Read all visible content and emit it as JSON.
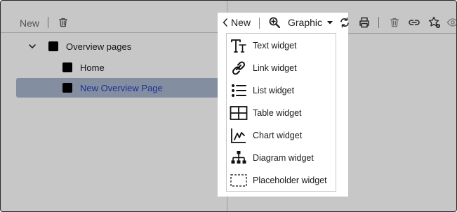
{
  "left_toolbar": {
    "new_label": "New",
    "delete_icon": "trash-icon"
  },
  "tree": {
    "items": [
      {
        "label": "Overview pages",
        "icon": "chevron-down-icon",
        "expanded": true,
        "selected": false
      },
      {
        "label": "Home",
        "selected": false
      },
      {
        "label": "New Overview Page",
        "selected": true
      }
    ]
  },
  "graphic_toolbar": {
    "back_label": "New",
    "back_icon": "chevron-left-icon",
    "zoom_icon": "zoom-in-icon",
    "graphic_label": "Graphic",
    "graphic_caret_icon": "caret-down-icon",
    "refresh_icon": "refresh-icon",
    "print_icon": "print-icon",
    "delete_icon": "trash-icon",
    "link_icon": "link-icon",
    "favorite_icon": "star-settings-icon",
    "eye_icon": "eye-icon"
  },
  "widget_menu": {
    "items": [
      {
        "label": "Text widget",
        "icon": "text-widget-icon"
      },
      {
        "label": "Link widget",
        "icon": "link-widget-icon"
      },
      {
        "label": "List widget",
        "icon": "list-widget-icon"
      },
      {
        "label": "Table widget",
        "icon": "table-widget-icon"
      },
      {
        "label": "Chart widget",
        "icon": "chart-widget-icon"
      },
      {
        "label": "Diagram widget",
        "icon": "diagram-widget-icon"
      },
      {
        "label": "Placeholder widget",
        "icon": "placeholder-widget-icon"
      }
    ]
  },
  "colors": {
    "selected_row_bg": "#aab6cf",
    "selected_row_text": "#1f3fbd",
    "dim_overlay": "rgba(0,0,0,0.22)"
  }
}
